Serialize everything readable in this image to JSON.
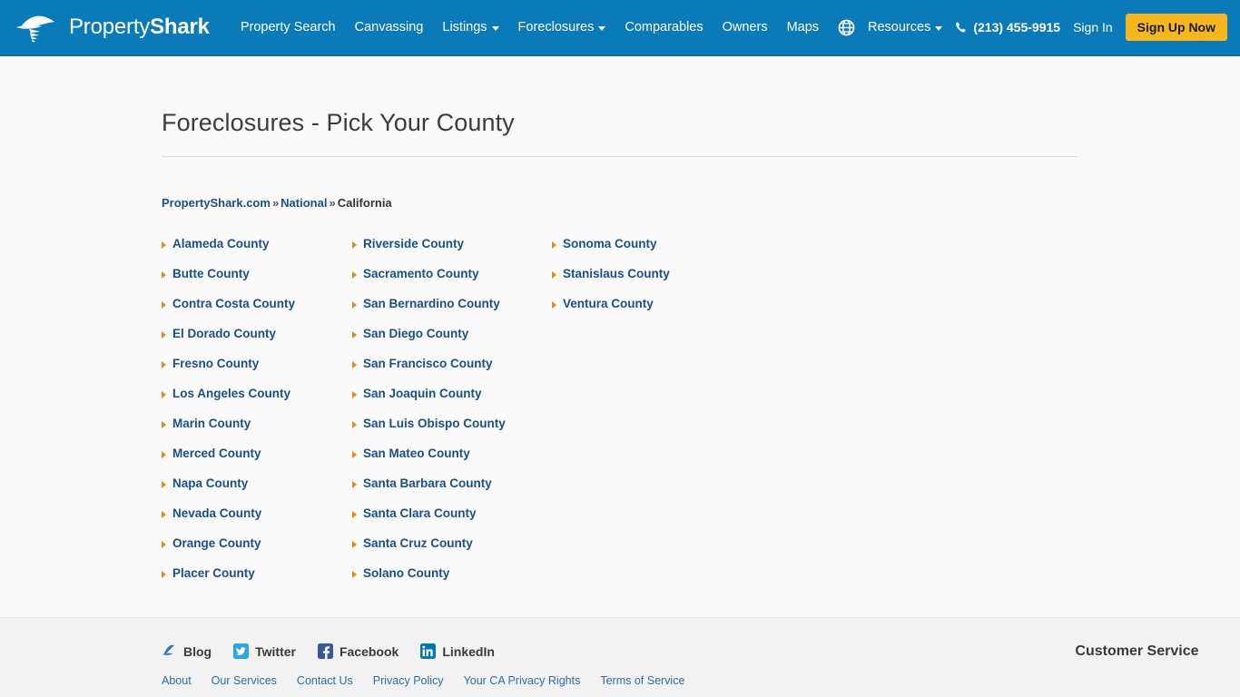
{
  "header": {
    "logo": {
      "icon": "shark-fin-icon",
      "text_light": "Property",
      "text_bold": "Shark"
    },
    "nav": [
      {
        "label": "Property Search",
        "has_caret": false
      },
      {
        "label": "Canvassing",
        "has_caret": false
      },
      {
        "label": "Listings",
        "has_caret": true
      },
      {
        "label": "Foreclosures",
        "has_caret": true
      },
      {
        "label": "Comparables",
        "has_caret": false
      },
      {
        "label": "Owners",
        "has_caret": false
      },
      {
        "label": "Maps",
        "has_caret": false
      }
    ],
    "globe_icon": "globe-icon",
    "resources_label": "Resources",
    "phone_icon": "phone-icon",
    "phone": "(213) 455-9915",
    "sign_in": "Sign In",
    "sign_up": "Sign Up Now",
    "colors": {
      "header_blue": "#0b7ab8",
      "header_border": "#0a6ca3",
      "signup_yellow": "#f5b71d"
    }
  },
  "main": {
    "title": "Foreclosures - Pick Your County",
    "breadcrumb": {
      "items": [
        {
          "label": "PropertyShark.com",
          "link": true
        },
        {
          "label": "National",
          "link": true
        },
        {
          "label": "California",
          "link": false
        }
      ],
      "separator": "»"
    },
    "arrow_icon": "arrow-right-icon",
    "link_color": "#1b4f8a",
    "bullet_color": "#e08b1e",
    "columns": [
      [
        "Alameda County",
        "Butte County",
        "Contra Costa County",
        "El Dorado County",
        "Fresno County",
        "Los Angeles County",
        "Marin County",
        "Merced County",
        "Napa County",
        "Nevada County",
        "Orange County",
        "Placer County"
      ],
      [
        "Riverside County",
        "Sacramento County",
        "San Bernardino County",
        "San Diego County",
        "San Francisco County",
        "San Joaquin County",
        "San Luis Obispo County",
        "San Mateo County",
        "Santa Barbara County",
        "Santa Clara County",
        "Santa Cruz County",
        "Solano County"
      ],
      [
        "Sonoma County",
        "Stanislaus County",
        "Ventura County"
      ]
    ]
  },
  "footer": {
    "social": [
      {
        "label": "Blog",
        "icon": "shark-fin-icon"
      },
      {
        "label": "Twitter",
        "icon": "twitter-icon"
      },
      {
        "label": "Facebook",
        "icon": "facebook-icon"
      },
      {
        "label": "LinkedIn",
        "icon": "linkedin-icon"
      }
    ],
    "links": [
      "About",
      "Our Services",
      "Contact Us",
      "Privacy Policy",
      "Your CA Privacy Rights",
      "Terms of Service"
    ],
    "customer_service_title": "Customer Service"
  }
}
